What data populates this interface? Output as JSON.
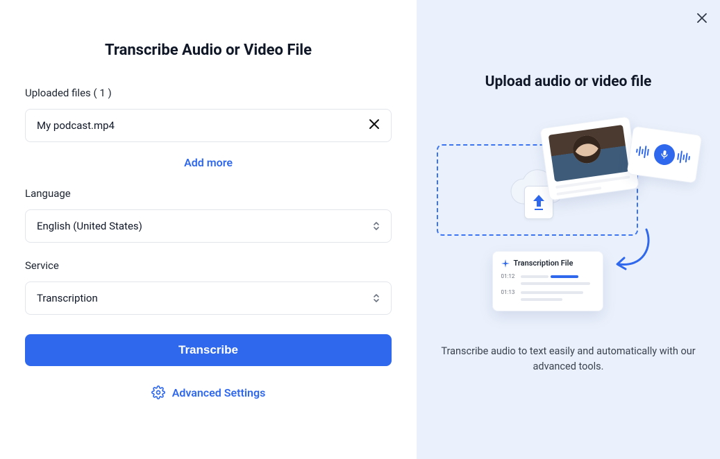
{
  "left": {
    "title": "Transcribe Audio or Video File",
    "uploaded_label": "Uploaded files ( 1 )",
    "file_name": "My podcast.mp4",
    "add_more": "Add more",
    "language_label": "Language",
    "language_value": "English (United States)",
    "service_label": "Service",
    "service_value": "Transcription",
    "transcribe_btn": "Transcribe",
    "advanced_settings": "Advanced Settings"
  },
  "right": {
    "title": "Upload audio or video file",
    "desc": "Transcribe audio to text easily and automatically with our advanced tools.",
    "transcript_card_title": "Transcription File",
    "timestamps": [
      "01:12",
      "01:13"
    ]
  }
}
